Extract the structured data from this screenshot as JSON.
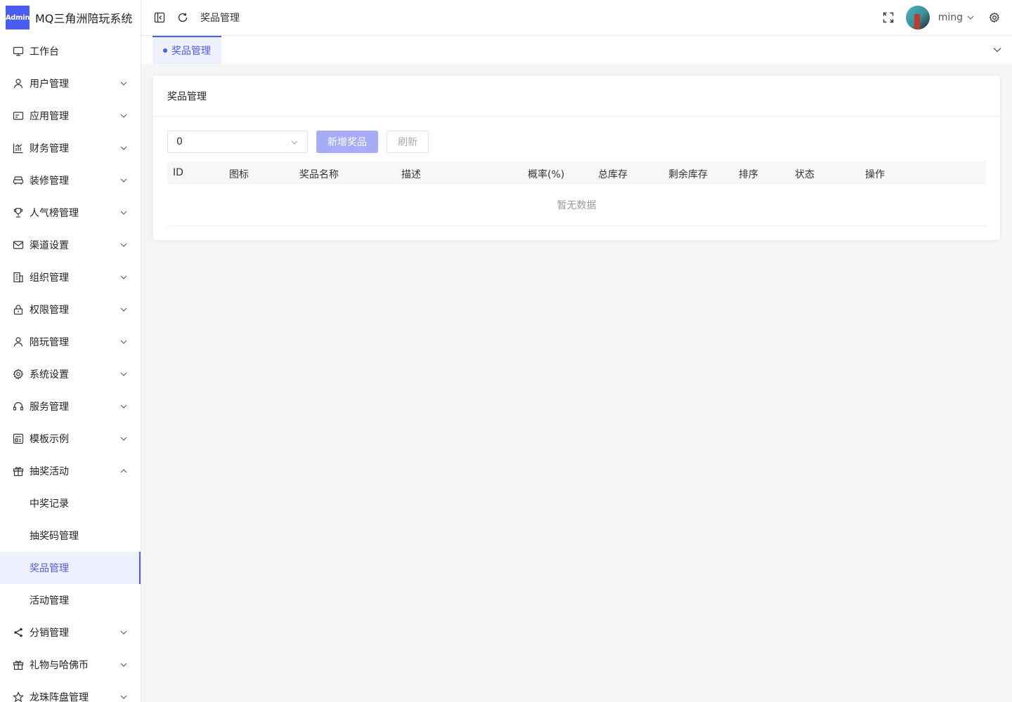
{
  "app": {
    "badge": "Admin",
    "title": "MQ三角洲陪玩系统"
  },
  "sidebar": {
    "items": [
      {
        "label": "工作台",
        "icon": "monitor-icon",
        "chevron": "none"
      },
      {
        "label": "用户管理",
        "icon": "user-icon",
        "chevron": "down"
      },
      {
        "label": "应用管理",
        "icon": "app-card-icon",
        "chevron": "down"
      },
      {
        "label": "财务管理",
        "icon": "bar-chart-icon",
        "chevron": "down"
      },
      {
        "label": "装修管理",
        "icon": "sofa-icon",
        "chevron": "down"
      },
      {
        "label": "人气榜管理",
        "icon": "trophy-icon",
        "chevron": "down"
      },
      {
        "label": "渠道设置",
        "icon": "mail-icon",
        "chevron": "down"
      },
      {
        "label": "组织管理",
        "icon": "building-icon",
        "chevron": "down"
      },
      {
        "label": "权限管理",
        "icon": "lock-icon",
        "chevron": "down"
      },
      {
        "label": "陪玩管理",
        "icon": "user-icon",
        "chevron": "down"
      },
      {
        "label": "系统设置",
        "icon": "gear-icon",
        "chevron": "down"
      },
      {
        "label": "服务管理",
        "icon": "headset-icon",
        "chevron": "down"
      },
      {
        "label": "模板示例",
        "icon": "template-icon",
        "chevron": "down"
      },
      {
        "label": "抽奖活动",
        "icon": "gift-icon",
        "chevron": "up"
      }
    ],
    "sub_items": [
      {
        "label": "中奖记录",
        "active": false
      },
      {
        "label": "抽奖码管理",
        "active": false
      },
      {
        "label": "奖品管理",
        "active": true
      },
      {
        "label": "活动管理",
        "active": false
      }
    ],
    "items_after": [
      {
        "label": "分销管理",
        "icon": "share-icon",
        "chevron": "down"
      },
      {
        "label": "礼物与哈佛币",
        "icon": "gift-icon",
        "chevron": "down"
      },
      {
        "label": "龙珠阵盘管理",
        "icon": "star-icon",
        "chevron": "down"
      }
    ]
  },
  "header": {
    "breadcrumb": "奖品管理",
    "username": "ming"
  },
  "tabs": [
    {
      "label": "奖品管理",
      "active": true
    }
  ],
  "card": {
    "title": "奖品管理",
    "select_value": "0",
    "add_button": "新增奖品",
    "refresh_button": "刷新",
    "columns": [
      "ID",
      "图标",
      "奖品名称",
      "描述",
      "概率(%)",
      "总库存",
      "剩余库存",
      "排序",
      "状态",
      "操作"
    ],
    "empty_text": "暂无数据"
  },
  "colors": {
    "accent": "#4b5cf0",
    "accent_light": "#eef0fd",
    "primary_disabled": "#a5adf7"
  }
}
